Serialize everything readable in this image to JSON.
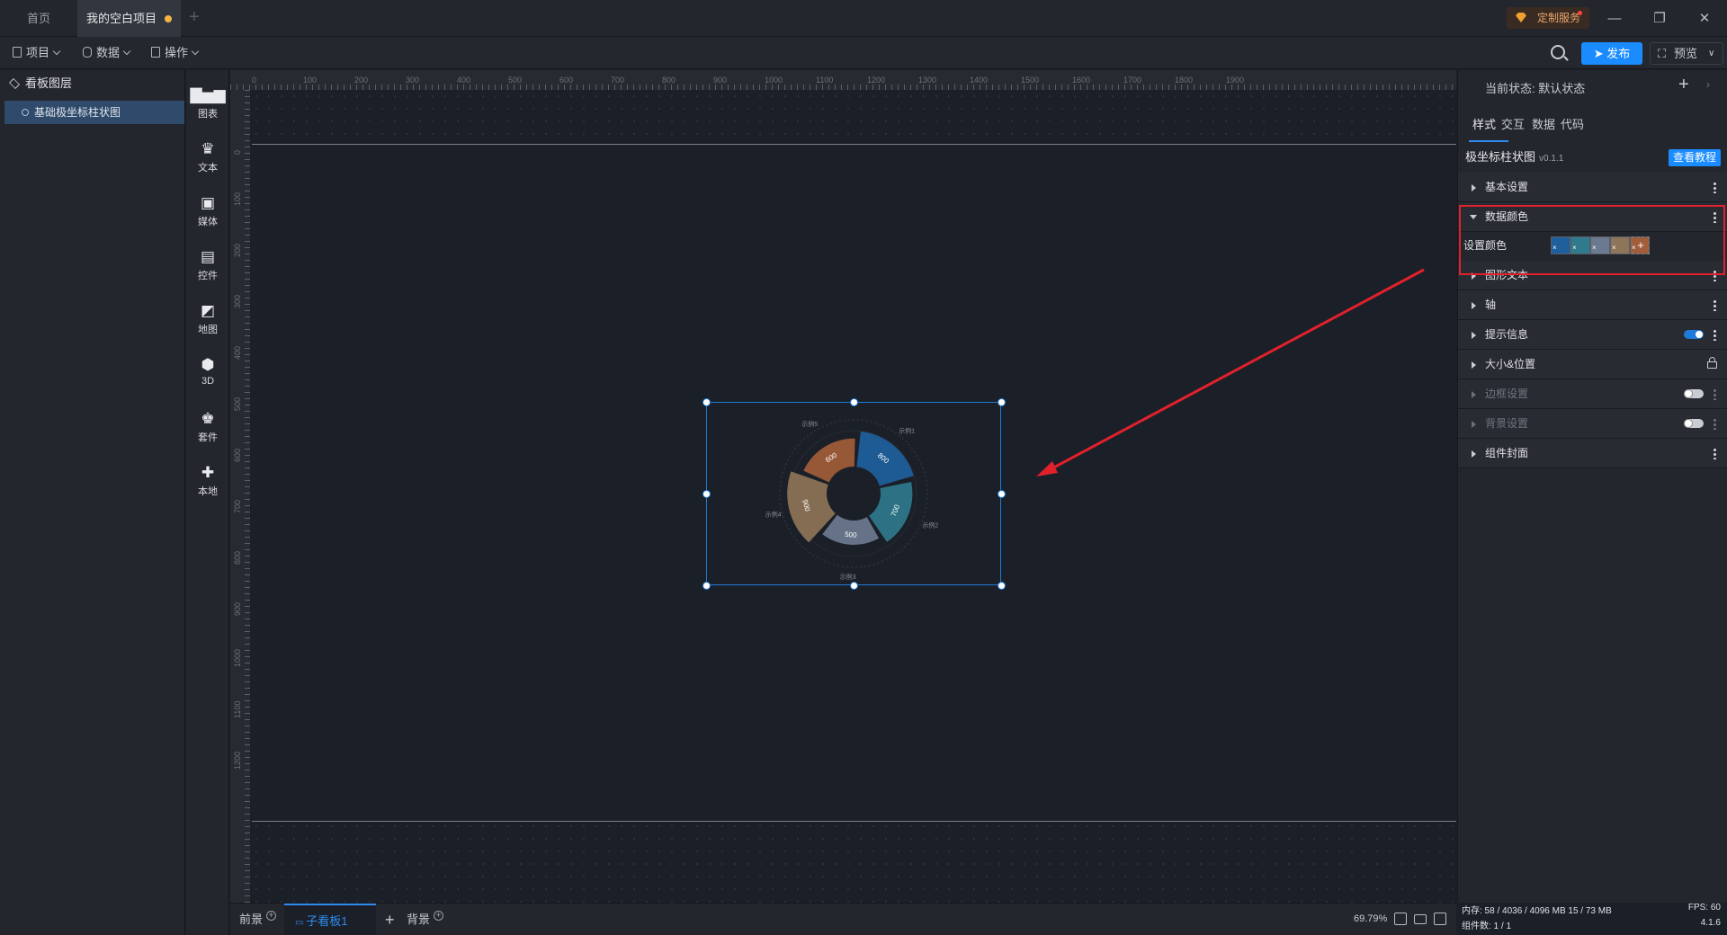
{
  "tabs": {
    "home": "首页",
    "project": "我的空白项目"
  },
  "service": {
    "label": "定制服务"
  },
  "window": {
    "minimize": "—",
    "restore": "❐",
    "close": "✕"
  },
  "menubar": {
    "project": "项目",
    "data": "数据",
    "operate": "操作",
    "publish": "发布",
    "preview": "预览"
  },
  "layers": {
    "title": "看板图层",
    "items": [
      "基础极坐标柱状图"
    ]
  },
  "tools": [
    "图表",
    "文本",
    "媒体",
    "控件",
    "地图",
    "3D",
    "套件",
    "本地"
  ],
  "ruler": {
    "top": [
      "0",
      "100",
      "200",
      "300",
      "400",
      "500",
      "600",
      "700",
      "800",
      "900",
      "1000",
      "1100",
      "1200",
      "1300",
      "1400",
      "1500",
      "1600",
      "1700",
      "1800",
      "1900"
    ],
    "left": [
      "0",
      "100",
      "200",
      "300",
      "400",
      "500",
      "600",
      "700",
      "800",
      "900",
      "1000",
      "1100",
      "1200"
    ]
  },
  "chart_data": {
    "type": "polar-bar",
    "categories": [
      "示例1",
      "示例2",
      "示例3",
      "示例4",
      "示例5"
    ],
    "values": [
      800,
      700,
      500,
      900,
      600
    ],
    "colors": [
      "#1e5f9c",
      "#2f7a8c",
      "#6b7a90",
      "#8e7458",
      "#a25d3a"
    ]
  },
  "bottombar": {
    "front": "前景",
    "board": "子看板1",
    "back": "背景",
    "zoom": "69.79%"
  },
  "panel": {
    "state": "当前状态:  默认状态",
    "tabs": [
      "样式",
      "交互",
      "数据",
      "代码"
    ],
    "component": "极坐标柱状图",
    "version": "v0.1.1",
    "tutorial": "查看教程",
    "sections": [
      "基本设置",
      "数据颜色",
      "图形文本",
      "轴",
      "提示信息",
      "大小&位置",
      "边框设置",
      "背景设置",
      "组件封面"
    ],
    "color_label": "设置颜色",
    "swatches": [
      "#1e5f9c",
      "#2f7a8c",
      "#6b7a90",
      "#8e7458",
      "#a25d3a"
    ]
  },
  "footer": {
    "memory": "内存:  58 / 4036 / 4096 MB  15 / 73 MB",
    "fps": "FPS:  60",
    "count": "组件数: 1 / 1",
    "app_version": "4.1.6"
  }
}
